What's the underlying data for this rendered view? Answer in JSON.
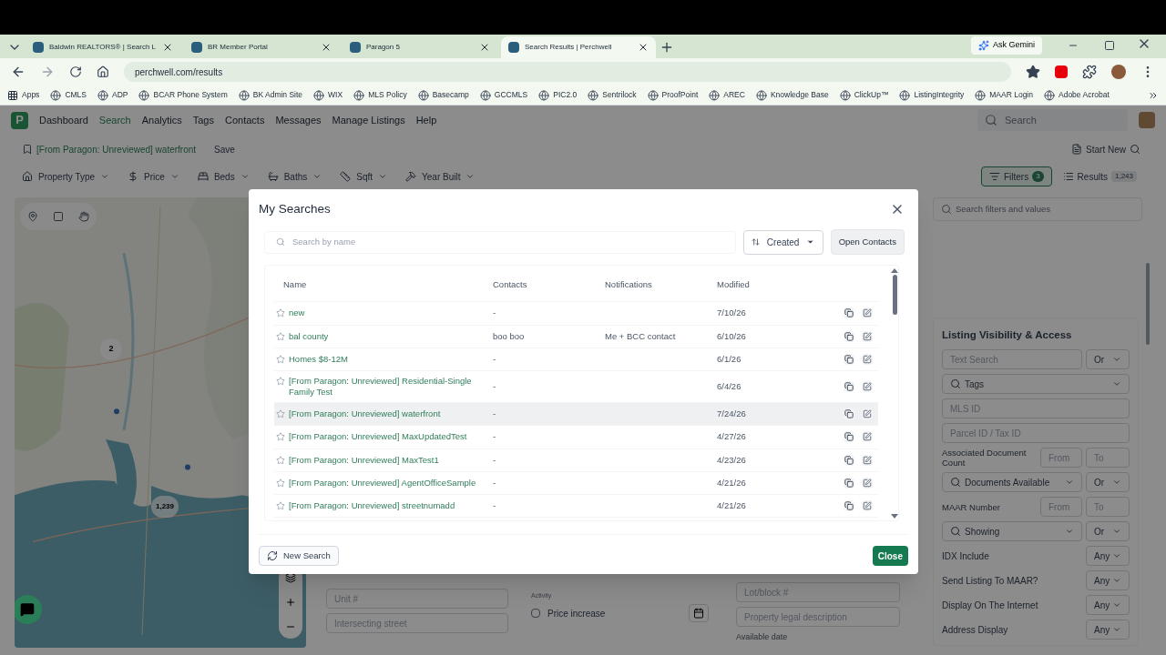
{
  "browser": {
    "tabs": [
      {
        "title": "Baldwin REALTORS® | Search L",
        "selected": false
      },
      {
        "title": "BR Member Portal",
        "selected": false
      },
      {
        "title": "Paragon 5",
        "selected": false
      },
      {
        "title": "Search Results | Perchwell",
        "selected": true
      }
    ],
    "gemini": "Ask Gemini",
    "url": "perchwell.com/results",
    "bookmarks": [
      "Apps",
      "CMLS",
      "ADP",
      "BCAR Phone System",
      "BK Admin Site",
      "WIX",
      "MLS Policy",
      "Basecamp",
      "GCCMLS",
      "PIC2.0",
      "Sentrilock",
      "ProofPoint",
      "AREC",
      "Knowledge Base",
      "ClickUp™",
      "ListingIntegrity",
      "MAAR Login",
      "Adobe Acrobat"
    ]
  },
  "app": {
    "logo": "P",
    "nav": [
      {
        "label": "Dashboard",
        "selected": false
      },
      {
        "label": "Search",
        "selected": true
      },
      {
        "label": "Analytics",
        "selected": false
      },
      {
        "label": "Tags",
        "selected": false
      },
      {
        "label": "Contacts",
        "selected": false
      },
      {
        "label": "Messages",
        "selected": false
      },
      {
        "label": "Manage Listings",
        "selected": false
      },
      {
        "label": "Help",
        "selected": false
      }
    ],
    "search_placeholder": "Search"
  },
  "saved_search": {
    "name": "[From Paragon: Unreviewed] waterfront",
    "save": "Save",
    "start_new": "Start New"
  },
  "filters": [
    "Property Type",
    "Price",
    "Beds",
    "Baths",
    "Sqft",
    "Year Built"
  ],
  "filters_button": {
    "label": "Filters",
    "count": "3"
  },
  "results_button": {
    "label": "Results",
    "count": "1,243"
  },
  "map": {
    "clusters": [
      "2",
      "1,239"
    ]
  },
  "form": {
    "left_fields": [
      "Unit #",
      "Intersecting street"
    ],
    "activity_heading": "Activity",
    "activity_items": [
      {
        "label": "Price increase",
        "checked": false
      }
    ],
    "middle_fields": [
      "Lot/block #",
      "Property legal description"
    ],
    "middle_label": "Available date"
  },
  "filter_panel": {
    "search_placeholder": "Search filters and values",
    "section": "Listing Visibility & Access",
    "rows": [
      {
        "kind": "text_op",
        "placeholder": "Text Search",
        "op": "Or"
      },
      {
        "kind": "select",
        "label": "Tags"
      },
      {
        "kind": "text",
        "placeholder": "MLS ID"
      },
      {
        "kind": "text",
        "placeholder": "Parcel ID / Tax ID"
      },
      {
        "kind": "range",
        "label": "Associated Document Count",
        "from": "From",
        "to": "To"
      },
      {
        "kind": "select_op",
        "label": "Documents Available",
        "op": "Or"
      },
      {
        "kind": "range",
        "label": "MAAR Number",
        "from": "From",
        "to": "To"
      },
      {
        "kind": "select_op",
        "label": "Showing",
        "op": "Or"
      },
      {
        "kind": "any",
        "label": "IDX Include",
        "value": "Any"
      },
      {
        "kind": "any",
        "label": "Send Listing To MAAR?",
        "value": "Any"
      },
      {
        "kind": "any",
        "label": "Display On The Internet",
        "value": "Any"
      },
      {
        "kind": "any",
        "label": "Address Display",
        "value": "Any"
      }
    ]
  },
  "modal": {
    "title": "My Searches",
    "search_placeholder": "Search by name",
    "sort": "Created",
    "open_contacts": "Open Contacts",
    "columns": [
      "Name",
      "Contacts",
      "Notifications",
      "Modified"
    ],
    "rows": [
      {
        "name": "new",
        "contacts": "-",
        "notifications": "",
        "modified": "7/10/26",
        "hovered": false
      },
      {
        "name": "bal county",
        "contacts": "boo boo",
        "notifications": "Me + BCC contact",
        "modified": "6/10/26",
        "hovered": false
      },
      {
        "name": "Homes $8-12M",
        "contacts": "-",
        "notifications": "",
        "modified": "6/1/26",
        "hovered": false
      },
      {
        "name": "[From Paragon: Unreviewed] Residential-Single Family Test",
        "contacts": "-",
        "notifications": "",
        "modified": "6/4/26",
        "hovered": false
      },
      {
        "name": "[From Paragon: Unreviewed] waterfront",
        "contacts": "-",
        "notifications": "",
        "modified": "7/24/26",
        "hovered": true
      },
      {
        "name": "[From Paragon: Unreviewed] MaxUpdatedTest",
        "contacts": "-",
        "notifications": "",
        "modified": "4/27/26",
        "hovered": false
      },
      {
        "name": "[From Paragon: Unreviewed] MaxTest1",
        "contacts": "-",
        "notifications": "",
        "modified": "4/23/26",
        "hovered": false
      },
      {
        "name": "[From Paragon: Unreviewed] AgentOfficeSample",
        "contacts": "-",
        "notifications": "",
        "modified": "4/21/26",
        "hovered": false
      },
      {
        "name": "[From Paragon: Unreviewed] streetnumadd",
        "contacts": "-",
        "notifications": "",
        "modified": "4/21/26",
        "hovered": false
      }
    ],
    "new_search": "New Search",
    "close": "Close"
  }
}
